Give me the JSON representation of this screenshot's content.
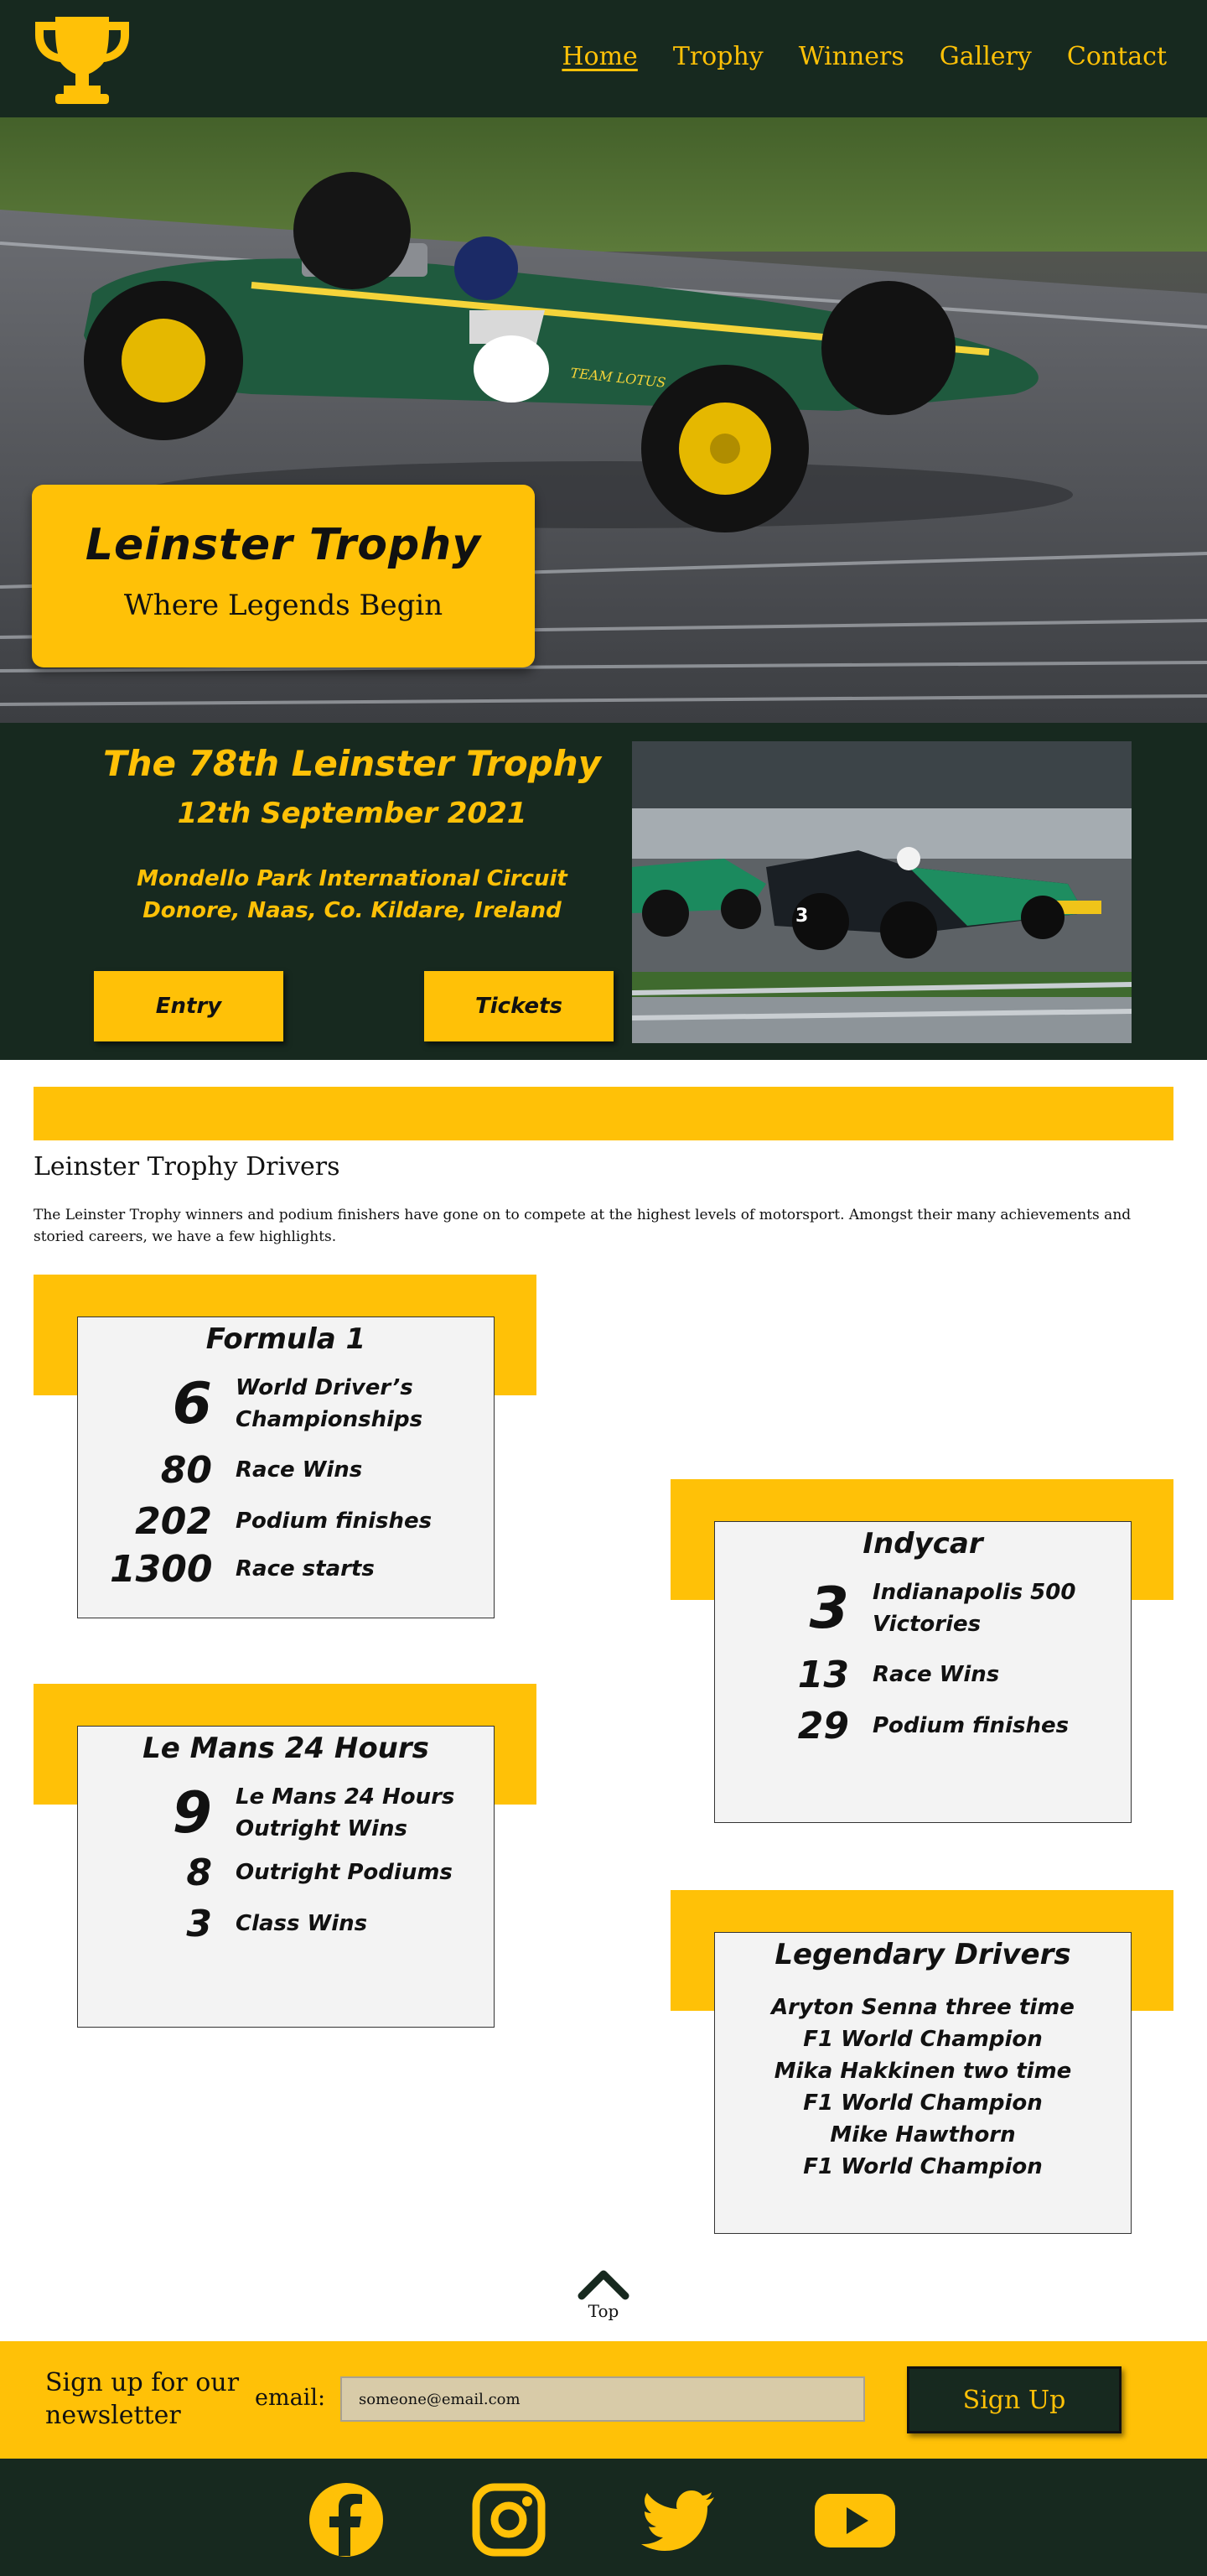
{
  "nav": {
    "links": [
      "Home",
      "Trophy",
      "Winners",
      "Gallery",
      "Contact"
    ],
    "logo_icon": "trophy-icon"
  },
  "hero": {
    "title": "Leinster Trophy",
    "subtitle": "Where Legends Begin"
  },
  "event": {
    "title": "The 78th Leinster Trophy",
    "date": "12th September 2021",
    "venue_line1": "Mondello Park International Circuit",
    "venue_line2": "Donore, Naas, Co. Kildare, Ireland",
    "entry_label": "Entry",
    "tickets_label": "Tickets"
  },
  "drivers": {
    "heading": "Leinster Trophy Drivers",
    "intro": "The Leinster Trophy winners and podium finishers have gone on to compete at the highest levels of motorsport. Amongst their many achievements and storied careers, we have a few highlights."
  },
  "formula1": {
    "title": "Formula 1",
    "stats": [
      {
        "value": "6",
        "label": "World Driver’s Championships"
      },
      {
        "value": "80",
        "label": "Race Wins"
      },
      {
        "value": "202",
        "label": "Podium finishes"
      },
      {
        "value": "1300",
        "label": "Race starts"
      }
    ]
  },
  "indycar": {
    "title": "Indycar",
    "stats": [
      {
        "value": "3",
        "label": "Indianapolis 500 Victories"
      },
      {
        "value": "13",
        "label": "Race Wins"
      },
      {
        "value": "29",
        "label": "Podium finishes"
      }
    ]
  },
  "lemans": {
    "title": "Le Mans 24 Hours",
    "stats": [
      {
        "value": "9",
        "label": "Le Mans 24 Hours Outright Wins"
      },
      {
        "value": "8",
        "label": "Outright Podiums"
      },
      {
        "value": "3",
        "label": "Class Wins"
      }
    ]
  },
  "legendary": {
    "title": "Legendary Drivers",
    "lines": [
      "Aryton Senna three time",
      "F1 World Champion",
      "Mika Hakkinen two time",
      "F1 World Champion",
      "Mike Hawthorn",
      "F1 World Champion"
    ]
  },
  "top_link": {
    "label": "Top",
    "icon": "chevron-up-icon"
  },
  "newsletter": {
    "title": "Sign up for our newsletter",
    "email_label": "email:",
    "email_value": "someone@email.com",
    "button_label": "Sign Up"
  },
  "footer": {
    "icons": [
      "facebook-icon",
      "instagram-icon",
      "twitter-icon",
      "youtube-icon"
    ]
  },
  "colors": {
    "accent": "#ffc107",
    "dark": "#17291f",
    "card_bg": "#f3f3f3"
  }
}
